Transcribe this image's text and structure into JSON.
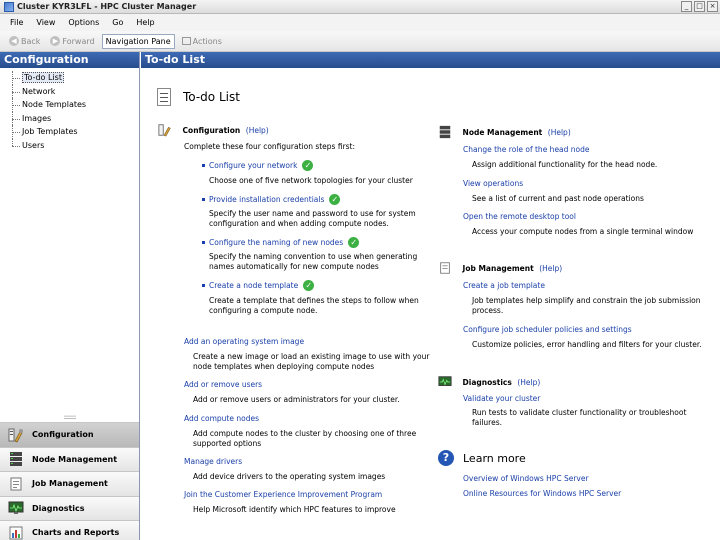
{
  "window": {
    "title": "Cluster KYR3LFL - HPC Cluster Manager",
    "controls": [
      "_",
      "□",
      "×"
    ]
  },
  "menu": [
    "File",
    "View",
    "Options",
    "Go",
    "Help"
  ],
  "toolbar": {
    "back": "Back",
    "forward": "Forward",
    "navigation_pane": "Navigation Pane",
    "actions": "Actions"
  },
  "nav": {
    "header": "Configuration",
    "tree": [
      "To-do List",
      "Network",
      "Node Templates",
      "Images",
      "Job Templates",
      "Users"
    ],
    "buttons": [
      "Configuration",
      "Node Management",
      "Job Management",
      "Diagnostics",
      "Charts and Reports"
    ],
    "splitter": "::::::::::::"
  },
  "main": {
    "header": "To-do List",
    "page_title": "To-do List",
    "configuration": {
      "title": "Configuration",
      "help": "(Help)",
      "intro": "Complete these four configuration steps first:",
      "steps": [
        {
          "link": "Configure your network",
          "desc": "Choose one of five network topologies for your cluster"
        },
        {
          "link": "Provide installation credentials",
          "desc": "Specify the user name and password to use for system configuration and when adding compute nodes."
        },
        {
          "link": "Configure the naming of new nodes",
          "desc": "Specify the naming convention to use when generating names automatically for new compute nodes"
        },
        {
          "link": "Create a node template",
          "desc": "Create a template that defines the steps to follow when configuring a compute node."
        }
      ],
      "tasks": [
        {
          "link": "Add an operating system image",
          "desc": "Create a new image or load an existing image to use with your node templates when deploying compute nodes"
        },
        {
          "link": "Add or remove users",
          "desc": "Add or remove users or administrators for your cluster."
        },
        {
          "link": "Add compute nodes",
          "desc": "Add compute nodes to the cluster by choosing one of three supported options"
        },
        {
          "link": "Manage drivers",
          "desc": "Add device drivers to the operating system images"
        },
        {
          "link": "Join the Customer Experience Improvement Program",
          "desc": "Help Microsoft identify which HPC features to improve"
        }
      ]
    },
    "node_management": {
      "title": "Node Management",
      "help": "(Help)",
      "tasks": [
        {
          "link": "Change the role of the head node",
          "desc": "Assign additional functionality for the head node."
        },
        {
          "link": "View operations",
          "desc": "See a list of current and past node operations"
        },
        {
          "link": "Open the remote desktop tool",
          "desc": "Access your compute nodes from a single terminal window"
        }
      ]
    },
    "job_management": {
      "title": "Job Management",
      "help": "(Help)",
      "tasks": [
        {
          "link": "Create a job template",
          "desc": "Job templates help simplify and constrain the job submission process."
        },
        {
          "link": "Configure job scheduler policies and settings",
          "desc": "Customize policies, error handling and filters for your cluster."
        }
      ]
    },
    "diagnostics": {
      "title": "Diagnostics",
      "help": "(Help)",
      "tasks": [
        {
          "link": "Validate your cluster",
          "desc": "Run tests to validate cluster functionality or troubleshoot failures."
        }
      ]
    },
    "learn_more": {
      "title": "Learn more",
      "links": [
        "Overview of Windows HPC Server",
        "Online Resources for Windows HPC Server"
      ]
    }
  }
}
